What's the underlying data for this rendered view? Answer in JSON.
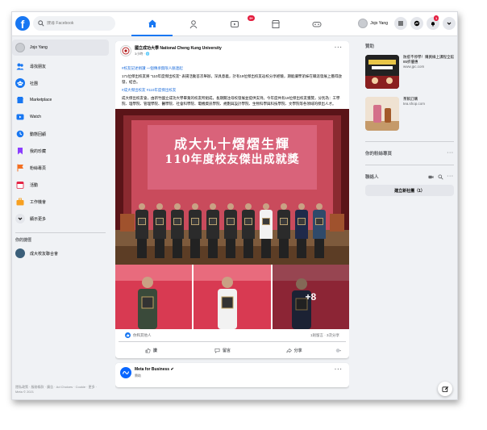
{
  "topbar": {
    "logo": "f",
    "search_placeholder": "搜尋 Facebook",
    "tabs": [
      {
        "name": "home",
        "icon": "home-icon",
        "active": true,
        "badge": ""
      },
      {
        "name": "friends",
        "icon": "friends-icon",
        "active": false,
        "badge": ""
      },
      {
        "name": "watch",
        "icon": "video-icon",
        "active": false,
        "badge": "9+"
      },
      {
        "name": "marketplace",
        "icon": "marketplace-icon",
        "active": false,
        "badge": ""
      },
      {
        "name": "gaming",
        "icon": "gaming-icon",
        "active": false,
        "badge": ""
      }
    ],
    "user_name": "Jojo Yang",
    "notification_badge": "1"
  },
  "sidebar": {
    "items": [
      {
        "label": "Jojo Yang",
        "icon": "avatar",
        "color": "#c9ccd1"
      },
      {
        "label": "尋找朋友",
        "icon": "friends-icon",
        "color": "#1877f2"
      },
      {
        "label": "社團",
        "icon": "groups-icon",
        "color": "#1877f2"
      },
      {
        "label": "Marketplace",
        "icon": "marketplace-icon",
        "color": "#1877f2"
      },
      {
        "label": "Watch",
        "icon": "watch-icon",
        "color": "#1877f2"
      },
      {
        "label": "動態回顧",
        "icon": "memories-icon",
        "color": "#1877f2"
      },
      {
        "label": "我的珍藏",
        "icon": "saved-icon",
        "color": "#8b3dff"
      },
      {
        "label": "粉絲專頁",
        "icon": "pages-icon",
        "color": "#f36f21"
      },
      {
        "label": "活動",
        "icon": "events-icon",
        "color": "#e41e3f"
      },
      {
        "label": "工作機會",
        "icon": "jobs-icon",
        "color": "#f7a021"
      },
      {
        "label": "顯示更多",
        "icon": "chevron-down-icon",
        "color": "#e4e6eb"
      }
    ],
    "shortcuts_title": "你的捷徑",
    "shortcut_item": "成大校友聯合會",
    "footer": "隱私政策 · 服務條款 · 廣告 · Ad Choices · Cookie · 更多 · Meta © 2021"
  },
  "post": {
    "author": "國立成功大學 National Cheng Kung University",
    "time": "3小時 · 🌐",
    "paragraph1": "#校友記述捐讚 一個傳承無限人脈連起",
    "paragraph2": "171位傑出校友將 \"110年度傑出校友\" 表揚活動首次舉辦，深具意義，計有19位傑出校友返校分享經驗，期能讓學弟妹在職涯發展上獲得啟發，結合。",
    "hashtag": "#成大傑出校友 #110年度傑出校友",
    "paragraph3": "成大傑出校友會，由新竹國立成功大學畢業的校友所組成，長期關注母校發展並提供支持。今年度共有19位傑出校友獲獎，分別為：工學院、理學院、管理學院、醫學院、社會科學院、電機資訊學院、規劃與設計學院、生物科學與科技學院、文學院等各領域的傑出人才。",
    "banner_line1": "成大九十熠熠生輝",
    "banner_line2": "110年度校友傑出成就獎",
    "more_photos": "+8",
    "reaction_count": "你和其他人",
    "comment_share": "1則留言 · 3次分享",
    "like_label": "讚",
    "comment_label": "留言",
    "share_label": "分享"
  },
  "post2": {
    "author": "Meta for Business ✔",
    "time": "贊助"
  },
  "rightcol": {
    "sponsored_title": "贊助",
    "ads": [
      {
        "title": "防疫不停學！購買線上課程全館85折優惠",
        "url": "www.jpc.com"
      },
      {
        "title": "茶飲訂購",
        "url": "tea.shop.com"
      }
    ],
    "birthdays": "你的粉絲專頁",
    "contacts": "聯絡人",
    "new_group": "建立新社團（1）"
  },
  "colors": {
    "brand": "#1877f2",
    "badge": "#e41e3f",
    "banner": "#d83a52"
  }
}
